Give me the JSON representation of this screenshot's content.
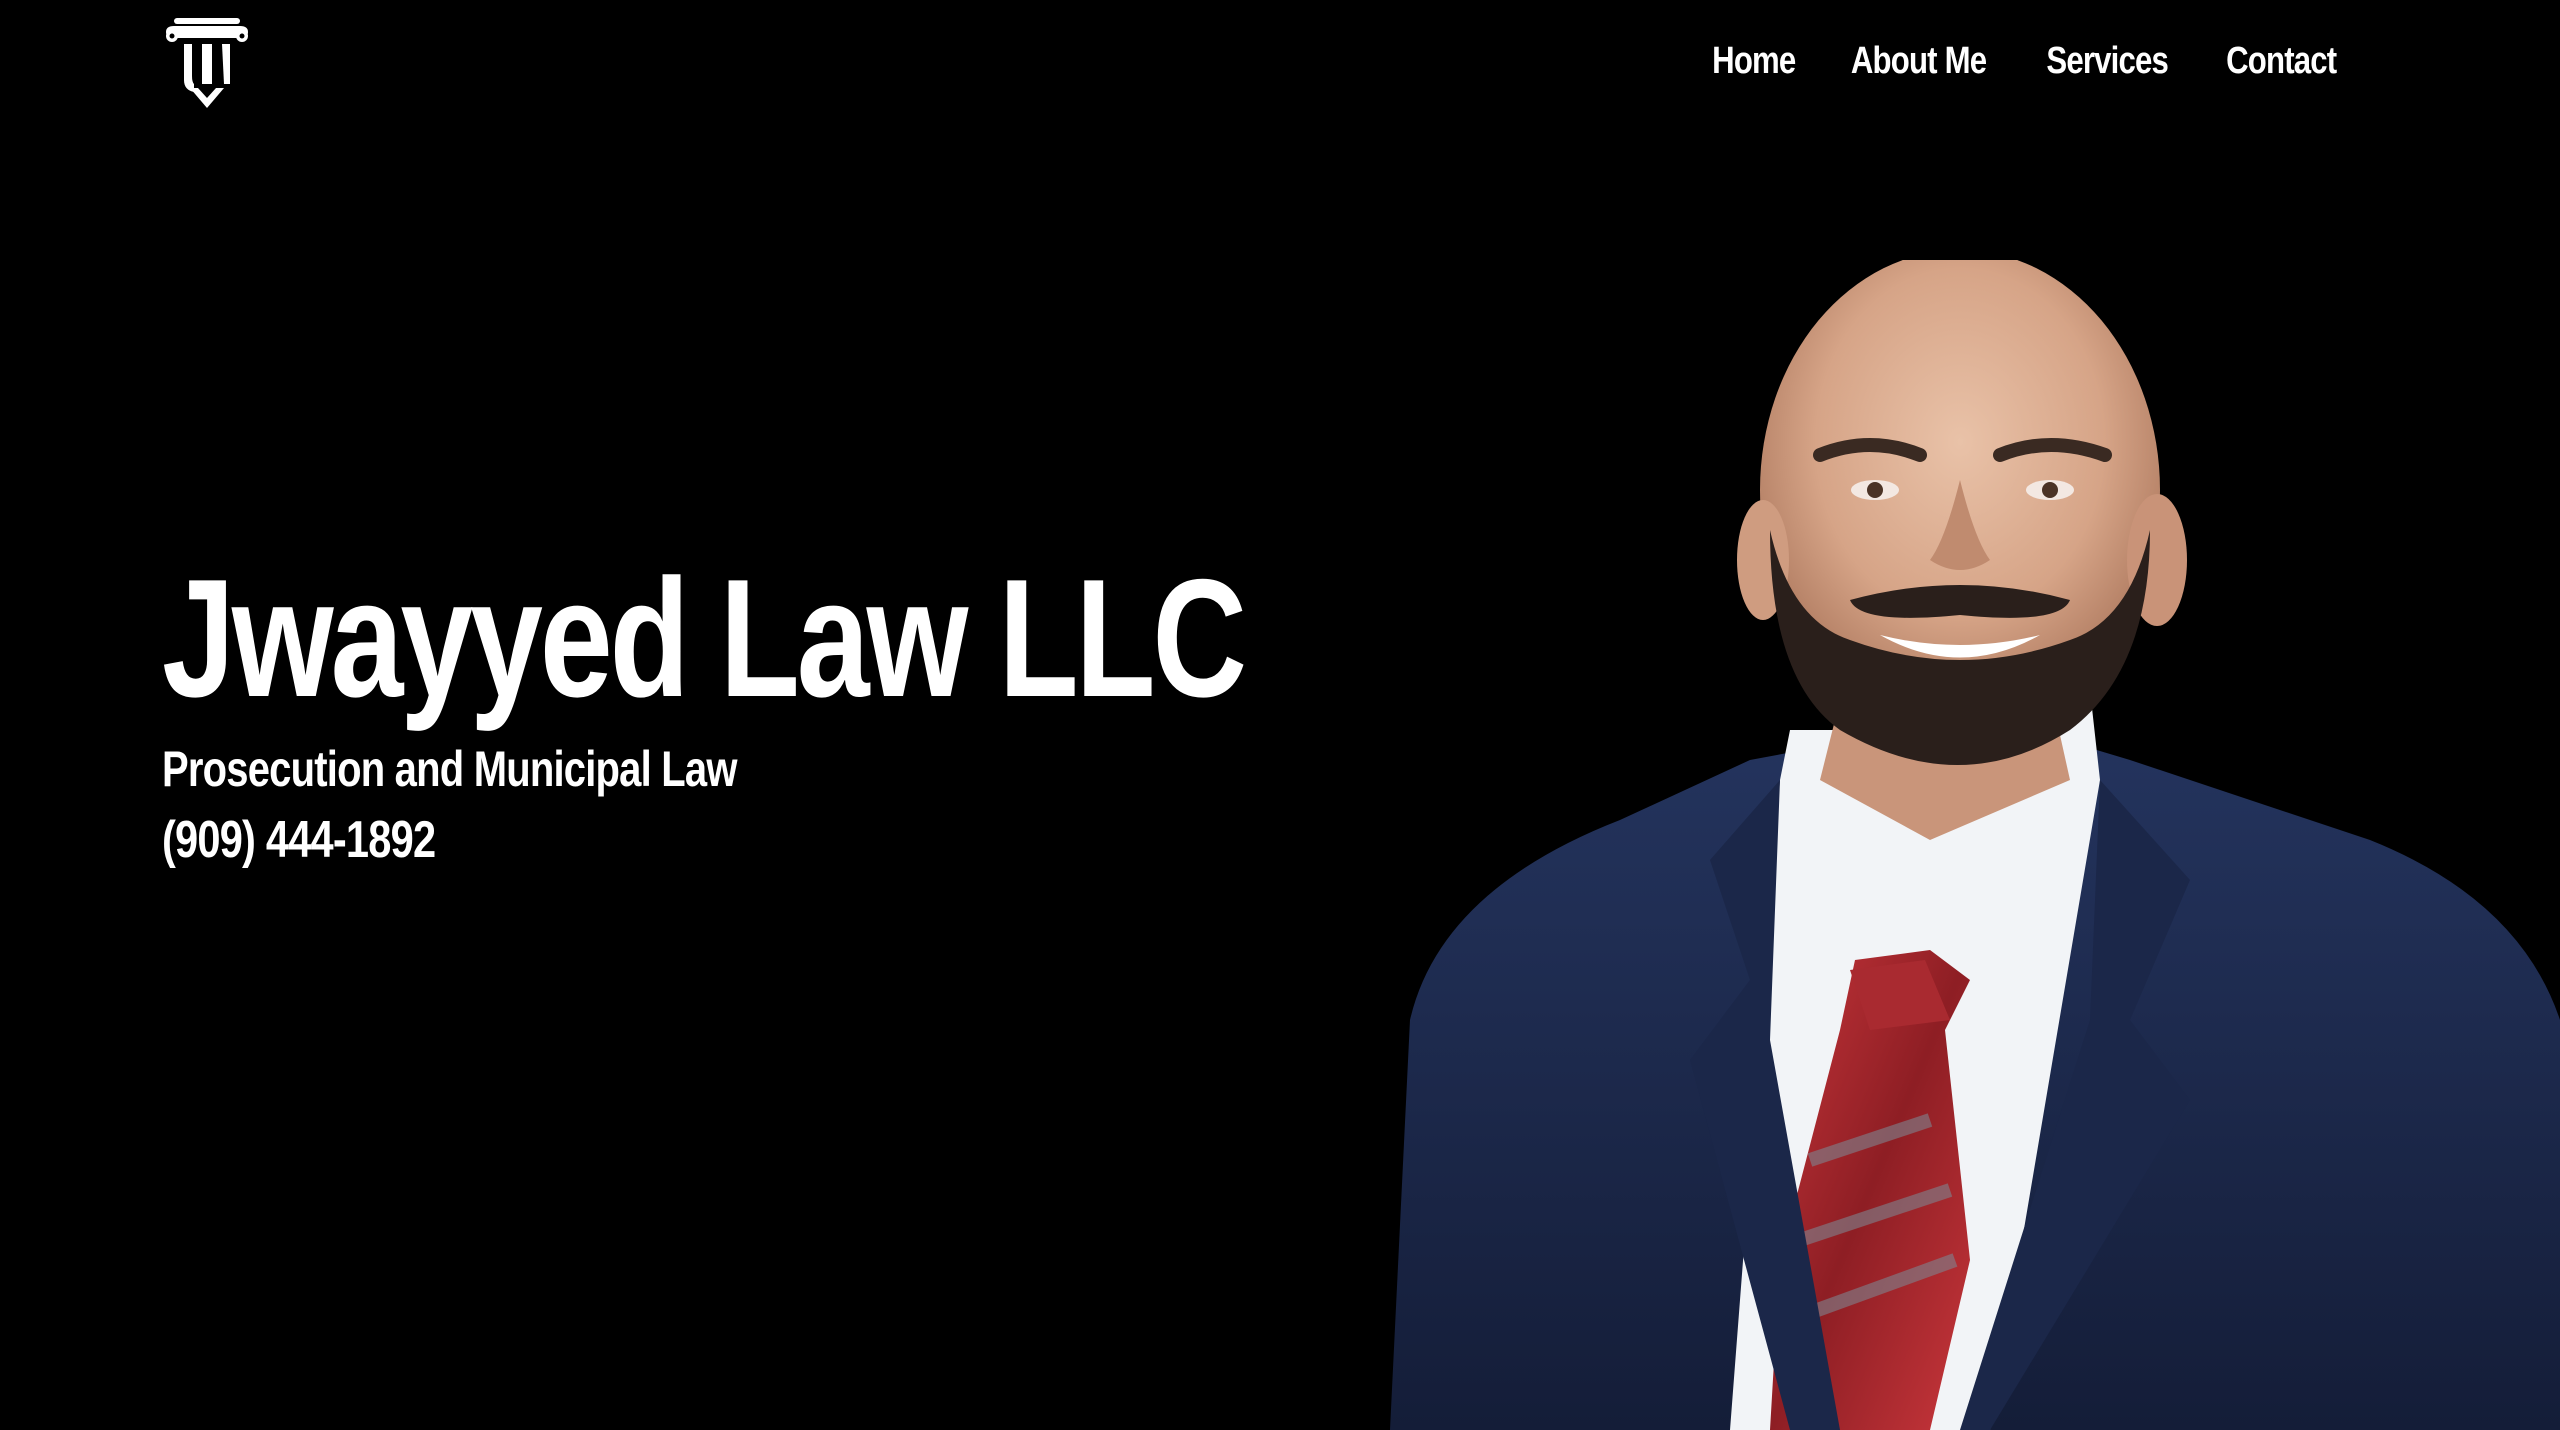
{
  "header": {
    "logo_icon": "pillar-jl-monogram-icon",
    "nav": [
      {
        "label": "Home"
      },
      {
        "label": "About Me"
      },
      {
        "label": "Services"
      },
      {
        "label": "Contact"
      }
    ]
  },
  "hero": {
    "title": "Jwayyed Law LLC",
    "subtitle": "Prosecution and Municipal Law",
    "phone": "(909) 444-1892",
    "portrait": "attorney-portrait-photo"
  },
  "colors": {
    "background": "#000000",
    "text": "#ffffff",
    "suit": "#1c2a4f",
    "tie": "#b3262b"
  }
}
